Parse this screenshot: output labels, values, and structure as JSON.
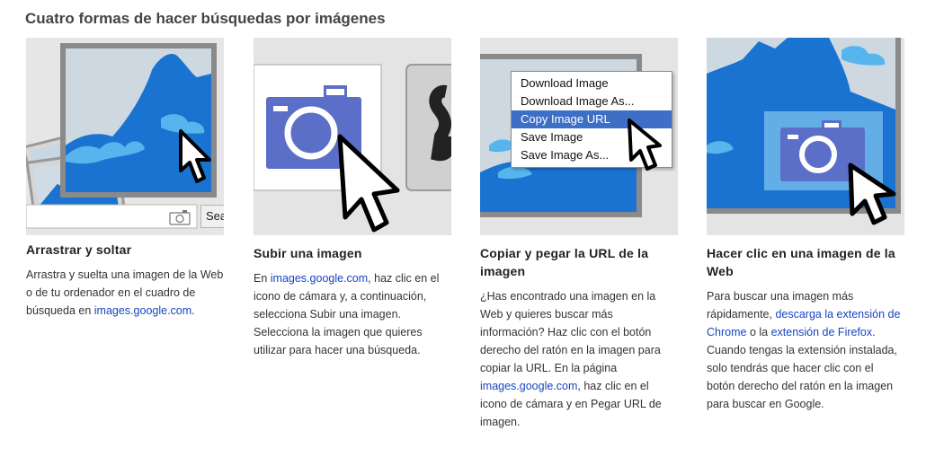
{
  "heading": "Cuatro formas de hacer búsquedas por imágenes",
  "cards": [
    {
      "title": "Arrastrar y soltar",
      "text_parts": [
        "Arrastra y suelta una imagen de la Web o de tu ordenador en el cuadro de búsqueda en ",
        "images.google.com",
        "."
      ],
      "search_button": "Sea"
    },
    {
      "title": "Subir una imagen",
      "text_parts": [
        "En ",
        "images.google.com",
        ", haz clic en el icono de cámara y, a continuación, selecciona Subir una imagen. Selecciona la imagen que quieres utilizar para hacer una búsqueda."
      ]
    },
    {
      "title": "Copiar y pegar la URL de la imagen",
      "text_parts": [
        "¿Has encontrado una imagen en la Web y quieres buscar más información? Haz clic con el botón derecho del ratón en la imagen para copiar la URL. En la página ",
        "images.google.com",
        ", haz clic en el icono de cámara y en Pegar URL de imagen."
      ],
      "context_menu": [
        "Download Image",
        "Download Image As...",
        "Copy Image URL",
        "Save Image",
        "Save Image As..."
      ],
      "selected_menu_index": 2
    },
    {
      "title": "Hacer clic en una imagen de la Web",
      "text_parts": [
        "Para buscar una imagen más rápidamente, ",
        "descarga la extensión de Chrome",
        " o la ",
        "extensión de Firefox",
        ". Cuando tengas la extensión instalada, solo tendrás que hacer clic con el botón derecho del ratón en la imagen para buscar en Google."
      ]
    }
  ],
  "colors": {
    "mountain_blue": "#1a73d1",
    "sky_blue": "#58b4ec",
    "camera_blue": "#5b6fc8",
    "link": "#1a44c2",
    "menu_highlight": "#3d6fc6"
  }
}
